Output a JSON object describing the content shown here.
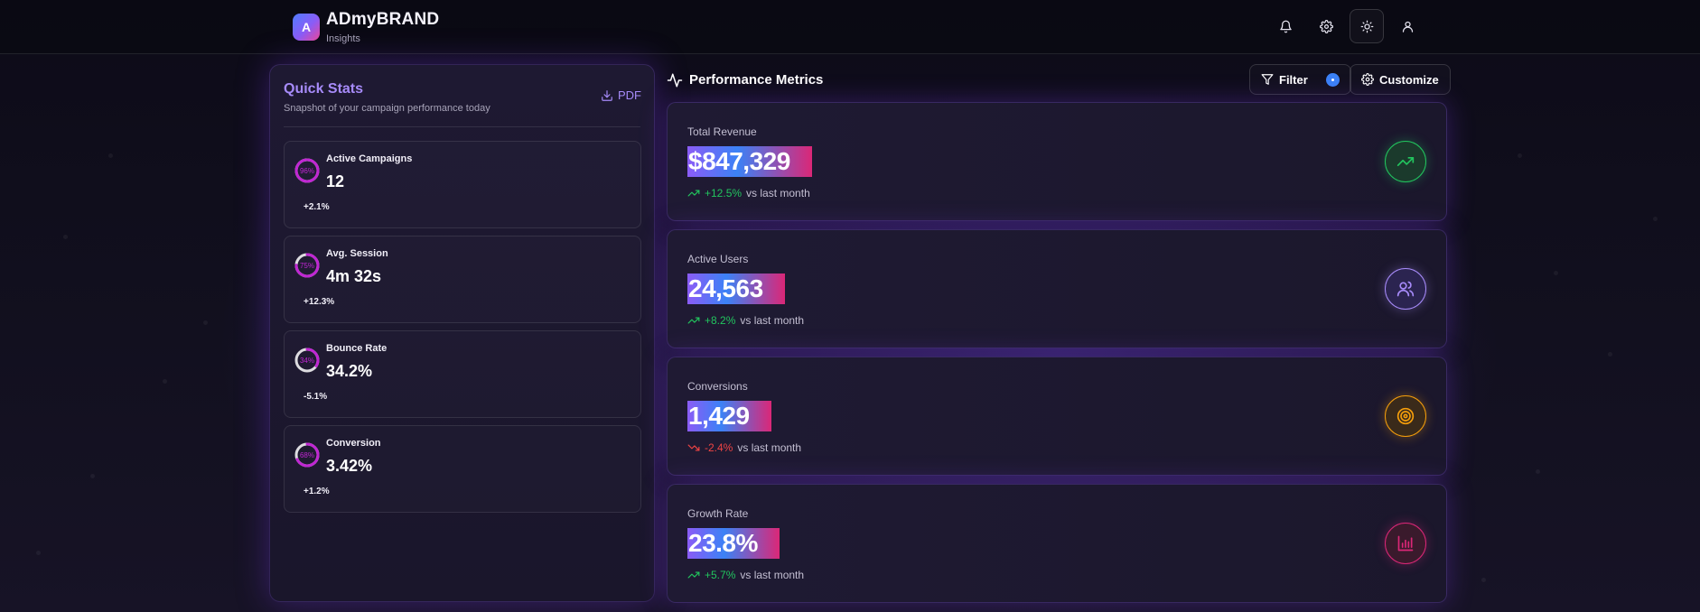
{
  "header": {
    "logo_letter": "A",
    "brand_name": "ADmyBRAND",
    "brand_sub": "Insights",
    "icons": [
      "bell-icon",
      "gear-icon",
      "sun-icon",
      "user-icon"
    ]
  },
  "quick_stats": {
    "title": "Quick Stats",
    "subtitle": "Snapshot of your campaign performance today",
    "pdf_label": "PDF",
    "items": [
      {
        "label": "Active Campaigns",
        "value": "12",
        "change": "+2.1%",
        "ring_percent": "96%",
        "ring_fraction": 0.96
      },
      {
        "label": "Avg. Session",
        "value": "4m 32s",
        "change": "+12.3%",
        "ring_percent": "75%",
        "ring_fraction": 0.75
      },
      {
        "label": "Bounce Rate",
        "value": "34.2%",
        "change": "-5.1%",
        "ring_percent": "34%",
        "ring_fraction": 0.34
      },
      {
        "label": "Conversion",
        "value": "3.42%",
        "change": "+1.2%",
        "ring_percent": "68%",
        "ring_fraction": 0.68
      }
    ]
  },
  "performance": {
    "title": "Performance Metrics",
    "filter_label": "Filter",
    "customize_label": "Customize",
    "metrics": [
      {
        "label": "Total Revenue",
        "value": "$847,329",
        "change": "+12.5%",
        "suffix": "vs last month",
        "trend": "up",
        "icon": "trending-up-icon",
        "color": "#22c55e"
      },
      {
        "label": "Active Users",
        "value": "24,563",
        "change": "+8.2%",
        "suffix": "vs last month",
        "trend": "up",
        "icon": "users-icon",
        "color": "#a78bfa"
      },
      {
        "label": "Conversions",
        "value": "1,429",
        "change": "-2.4%",
        "suffix": "vs last month",
        "trend": "down",
        "icon": "target-icon",
        "color": "#f59e0b"
      },
      {
        "label": "Growth Rate",
        "value": "23.8%",
        "change": "+5.7%",
        "suffix": "vs last month",
        "trend": "up",
        "icon": "bar-chart-icon",
        "color": "#db2777"
      }
    ]
  },
  "colors": {
    "accent": "#a78bfa",
    "positive": "#22c55e",
    "negative": "#ef4444",
    "ring": "#c026d3"
  }
}
